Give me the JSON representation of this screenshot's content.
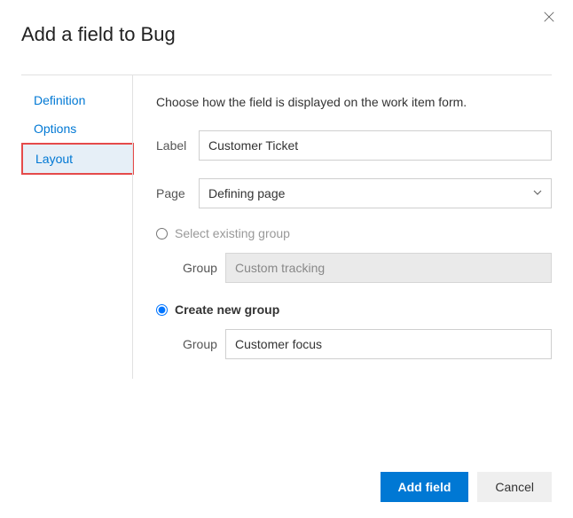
{
  "title": "Add a field to Bug",
  "sidebar": {
    "items": [
      {
        "label": "Definition"
      },
      {
        "label": "Options"
      },
      {
        "label": "Layout"
      }
    ]
  },
  "content": {
    "intro": "Choose how the field is displayed on the work item form.",
    "label_field": {
      "label": "Label",
      "value": "Customer Ticket"
    },
    "page_field": {
      "label": "Page",
      "value": "Defining page"
    },
    "existing_group": {
      "radio_label": "Select existing group",
      "group_label": "Group",
      "group_value": "Custom tracking"
    },
    "new_group": {
      "radio_label": "Create new group",
      "group_label": "Group",
      "group_value": "Customer focus"
    }
  },
  "footer": {
    "primary": "Add field",
    "secondary": "Cancel"
  }
}
